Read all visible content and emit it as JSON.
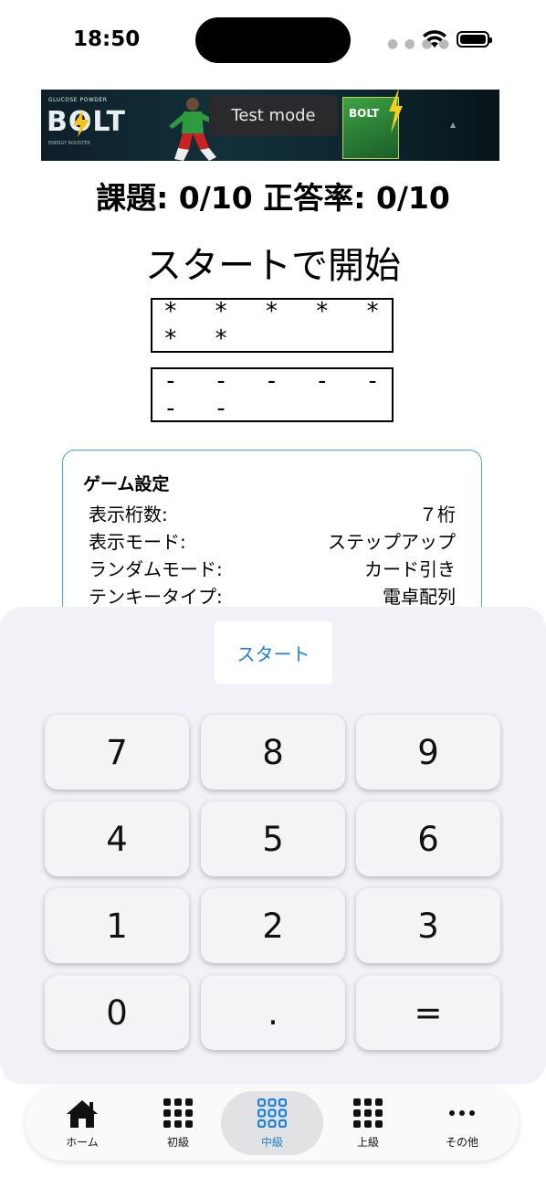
{
  "status_bar": {
    "time": "18:50",
    "signal_icon": "signal-dots-icon",
    "wifi_icon": "wifi-icon",
    "battery_icon": "battery-icon"
  },
  "ad": {
    "brand_small": "GLUCOSE POWDER",
    "brand": "BOLT",
    "tagline": "ENERGY BOOSTER",
    "test_label": "Test mode",
    "info_icon": "ad-info-icon"
  },
  "score": {
    "text": "課題: 0/10 正答率: 0/10"
  },
  "status_message": "スタートで開始",
  "display": {
    "question": "* * * * * * *",
    "answer": "- - - - - - -"
  },
  "settings": {
    "title": "ゲーム設定",
    "rows": [
      {
        "key": "表示桁数:",
        "value": "７桁"
      },
      {
        "key": "表示モード:",
        "value": "ステップアップ"
      },
      {
        "key": "ランダムモード:",
        "value": "カード引き"
      },
      {
        "key": "テンキータイプ:",
        "value": "電卓配列"
      }
    ]
  },
  "start_button": "スタート",
  "keypad": {
    "keys": [
      "7",
      "8",
      "9",
      "4",
      "5",
      "6",
      "1",
      "2",
      "3",
      "0",
      ".",
      "="
    ]
  },
  "tabbar": {
    "active_index": 2,
    "items": [
      {
        "label": "ホーム",
        "icon": "home-icon"
      },
      {
        "label": "初級",
        "icon": "grid-icon"
      },
      {
        "label": "中級",
        "icon": "grid-icon"
      },
      {
        "label": "上級",
        "icon": "grid-icon"
      },
      {
        "label": "その他",
        "icon": "more-icon"
      }
    ]
  },
  "colors": {
    "accent": "#1f82d8",
    "settings_border": "#4a9fe0",
    "pad_bg": "#f1f1f7"
  }
}
